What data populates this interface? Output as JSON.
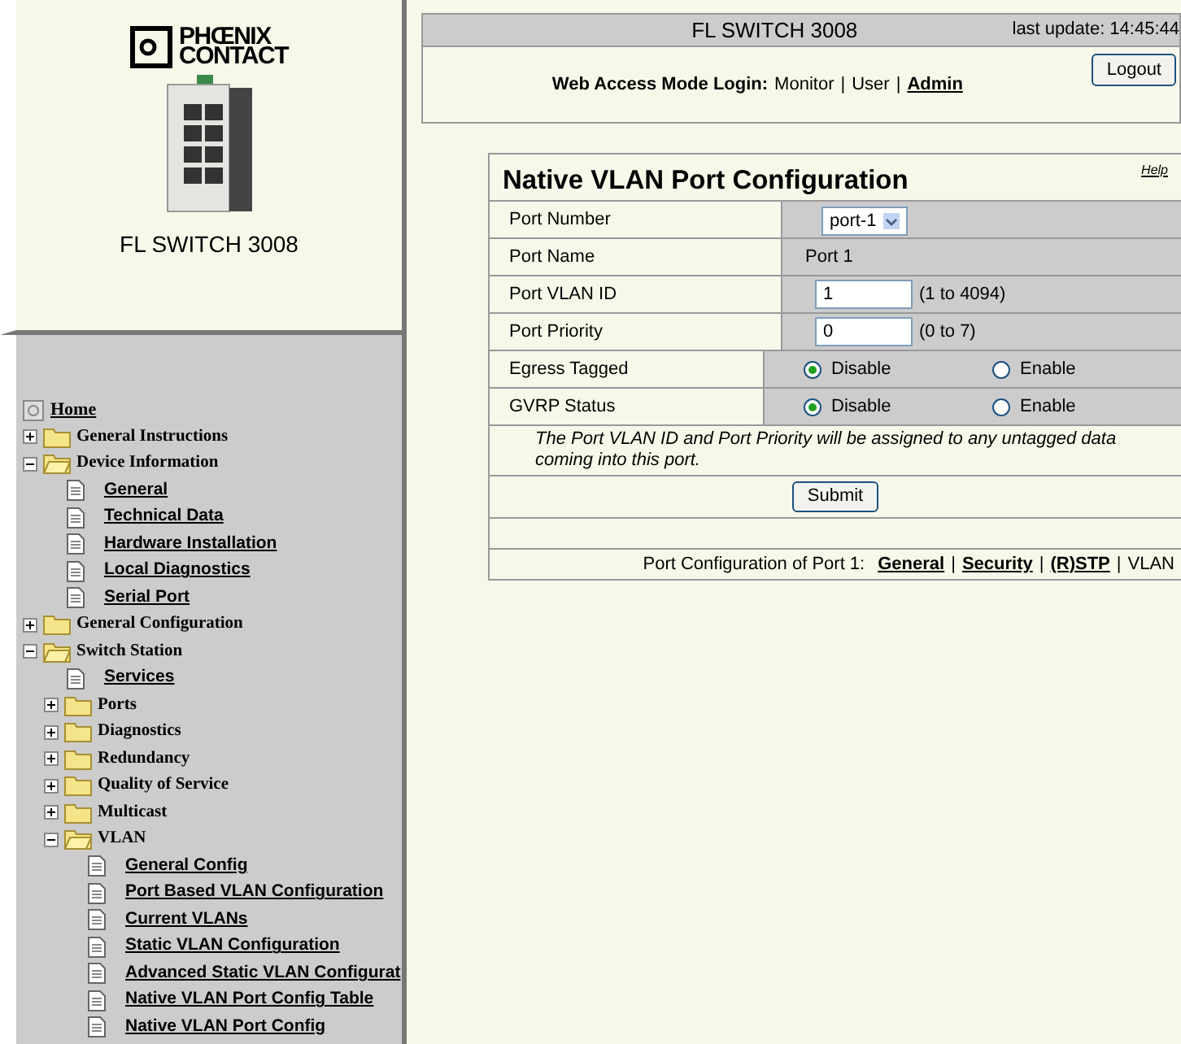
{
  "sidebar": {
    "logo": {
      "line1": "PHŒNIX",
      "line2": "CONTACT"
    },
    "device_name": "FL SWITCH 3008",
    "tree": [
      {
        "kind": "home",
        "label": "Home"
      },
      {
        "kind": "folder",
        "label": "General Instructions",
        "expanded": false
      },
      {
        "kind": "folder",
        "label": "Device Information",
        "expanded": true,
        "children": [
          {
            "kind": "page",
            "label": "General"
          },
          {
            "kind": "page",
            "label": "Technical Data"
          },
          {
            "kind": "page",
            "label": "Hardware Installation"
          },
          {
            "kind": "page",
            "label": "Local Diagnostics"
          },
          {
            "kind": "page",
            "label": "Serial Port"
          }
        ]
      },
      {
        "kind": "folder",
        "label": "General Configuration",
        "expanded": false
      },
      {
        "kind": "folder",
        "label": "Switch Station",
        "expanded": true,
        "children": [
          {
            "kind": "page",
            "label": "Services"
          },
          {
            "kind": "folder",
            "label": "Ports",
            "expanded": false
          },
          {
            "kind": "folder",
            "label": "Diagnostics",
            "expanded": false
          },
          {
            "kind": "folder",
            "label": "Redundancy",
            "expanded": false
          },
          {
            "kind": "folder",
            "label": "Quality of Service",
            "expanded": false
          },
          {
            "kind": "folder",
            "label": "Multicast",
            "expanded": false
          },
          {
            "kind": "folder",
            "label": "VLAN",
            "expanded": true,
            "children": [
              {
                "kind": "page",
                "label": "General Config"
              },
              {
                "kind": "page",
                "label": "Port Based VLAN Configuration"
              },
              {
                "kind": "page",
                "label": "Current VLANs"
              },
              {
                "kind": "page",
                "label": "Static VLAN Configuration"
              },
              {
                "kind": "page",
                "label": "Advanced Static VLAN Configurat"
              },
              {
                "kind": "page",
                "label": "Native VLAN Port Config Table"
              },
              {
                "kind": "page",
                "label": "Native VLAN Port Config"
              }
            ]
          }
        ]
      }
    ]
  },
  "header": {
    "title": "FL SWITCH 3008",
    "last_update": "last update: 14:45:44",
    "login_label": "Web Access Mode Login:",
    "separator": "|",
    "modes": [
      {
        "label": "Monitor",
        "selected": false
      },
      {
        "label": "User",
        "selected": false
      },
      {
        "label": "Admin",
        "selected": true
      }
    ],
    "logout": "Logout"
  },
  "form": {
    "title": "Native VLAN Port Configuration",
    "help": "Help",
    "rows": [
      {
        "kind": "select",
        "label": "Port Number",
        "value": "port-1"
      },
      {
        "kind": "text",
        "label": "Port Name",
        "value": "Port 1"
      },
      {
        "kind": "input",
        "label": "Port VLAN ID",
        "value": "1",
        "hint": "(1 to 4094)"
      },
      {
        "kind": "input",
        "label": "Port Priority",
        "value": "0",
        "hint": "(0 to 7)"
      },
      {
        "kind": "radio",
        "label": "Egress Tagged",
        "options": [
          {
            "label": "Disable",
            "selected": true
          },
          {
            "label": "Enable",
            "selected": false
          }
        ]
      },
      {
        "kind": "radio",
        "label": "GVRP Status",
        "options": [
          {
            "label": "Disable",
            "selected": true
          },
          {
            "label": "Enable",
            "selected": false
          }
        ]
      }
    ],
    "note": "The Port VLAN ID and Port Priority will be assigned to any untagged data coming into this port.",
    "submit": "Submit",
    "footer_label": "Port Configuration of Port 1:",
    "footer_separator": "|",
    "footer_links": [
      {
        "label": "General",
        "link": true
      },
      {
        "label": "Security",
        "link": true
      },
      {
        "label": "(R)STP",
        "link": true
      },
      {
        "label": "VLAN",
        "link": false
      }
    ]
  }
}
